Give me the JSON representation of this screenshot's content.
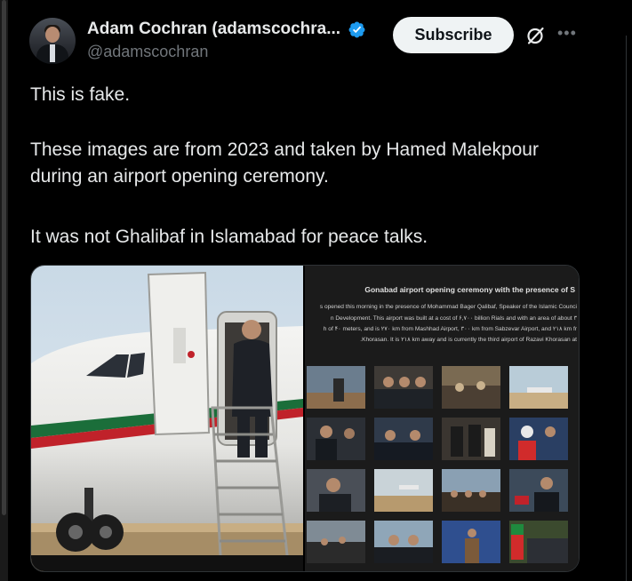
{
  "author": {
    "display_name": "Adam Cochran (adamscochra...",
    "handle": "@adamscochran",
    "verified": true
  },
  "actions": {
    "subscribe_label": "Subscribe",
    "grok_icon": "grok-icon",
    "more_icon": "more-icon",
    "more_glyph": "•••"
  },
  "tweet": {
    "line1": "This is fake.",
    "line2": "These images are from 2023 and taken by Hamed Malekpour during an airport opening ceremony.",
    "line3": "It was not Ghalibaf in Islamabad for peace talks."
  },
  "media": {
    "article_title": "Gonabad airport opening ceremony with the presence of S",
    "article_lines": [
      "s opened this morning in the presence of Mohammad Bager Qalibaf, Speaker of the Islamic Counci",
      "n Development. This airport was built at a cost of ۶,۷۰۰ billion Rials and with an area of about ۳",
      "h of ۴۰ meters, and is ۲۷۰ km from Mashhad Airport, ۳۰۰ km from Sabzevar Airport, and ۲۱۸ km fr",
      ".Khorasan. It is ۲۱۸ km away and is currently the third airport of Razavi Khorasan at"
    ]
  },
  "colors": {
    "background": "#000000",
    "text": "#e7e9ea",
    "muted": "#71767b",
    "verified_blue": "#1d9bf0",
    "subscribe_bg": "#eff3f4"
  }
}
